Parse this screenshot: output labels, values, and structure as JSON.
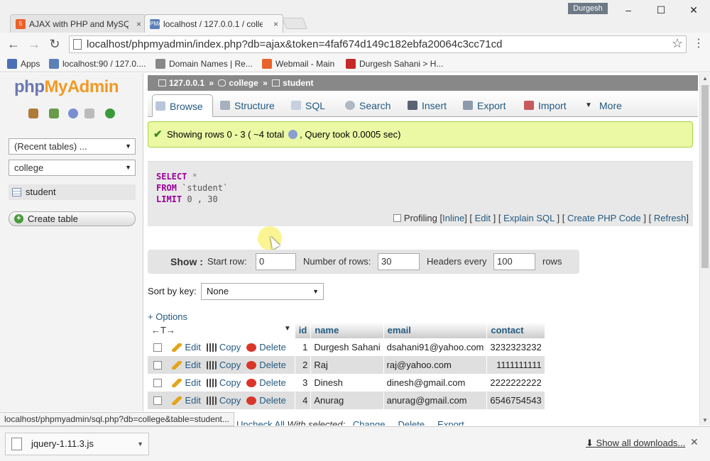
{
  "browser": {
    "tabs": [
      {
        "title": "AJAX with PHP and MySQ",
        "favicon": "html-icon"
      },
      {
        "title": "localhost / 127.0.0.1 / colle",
        "favicon": "pma-icon"
      }
    ],
    "tab_close": "×",
    "profile": "Durgesh",
    "url": "localhost/phpmyadmin/index.php?db=ajax&token=4faf674d149c182ebfa20064c3cc71cd",
    "bookmarks": [
      {
        "label": "Apps",
        "color": "#4a6fb5"
      },
      {
        "label": "localhost:90 / 127.0....",
        "color": "#5b7fb8"
      },
      {
        "label": "Domain Names | Re...",
        "color": "#888888"
      },
      {
        "label": "Webmail - Main",
        "color": "#e8622a"
      },
      {
        "label": "Durgesh Sahani > H...",
        "color": "#c62828"
      }
    ],
    "status_url": "localhost/phpmyadmin/sql.php?db=college&table=student...",
    "download_file": "jquery-1.11.3.js",
    "show_all_downloads": "Show all downloads..."
  },
  "nav": {
    "logo_part1": "php",
    "logo_part2": "MyAdmin",
    "recent_tables": "(Recent tables) ...",
    "database": "college",
    "table": "student",
    "create_table": "Create table"
  },
  "breadcrumb": {
    "server": "127.0.0.1",
    "database": "college",
    "table": "student",
    "separator": "»"
  },
  "tabs": [
    "Browse",
    "Structure",
    "SQL",
    "Search",
    "Insert",
    "Export",
    "Import",
    "More"
  ],
  "message": {
    "text": "Showing rows 0 - 3 ( ~4 total",
    "query_time": ", Query took 0.0005 sec)"
  },
  "sql": {
    "kw_select": "SELECT",
    "star": "*",
    "kw_from": "FROM",
    "table": "`student`",
    "kw_limit": "LIMIT",
    "limit_vals": "0 , 30",
    "profiling": "Profiling",
    "links": [
      "Inline",
      "Edit",
      "Explain SQL",
      "Create PHP Code",
      "Refresh"
    ]
  },
  "show": {
    "label": "Show :",
    "start_row_label": "Start row:",
    "start_row": "0",
    "num_rows_label": "Number of rows:",
    "num_rows": "30",
    "headers_every_label": "Headers every",
    "headers_every": "100",
    "rows_label": "rows"
  },
  "sort": {
    "label": "Sort by key:",
    "value": "None"
  },
  "options_label": "+ Options",
  "table": {
    "column_controls": "←T→",
    "headers": [
      "id",
      "name",
      "email",
      "contact"
    ],
    "actions": [
      "Edit",
      "Copy",
      "Delete"
    ],
    "rows": [
      {
        "id": "1",
        "name": "Durgesh Sahani",
        "email": "dsahani91@yahoo.com",
        "contact": "3232323232"
      },
      {
        "id": "2",
        "name": "Raj",
        "email": "raj@yahoo.com",
        "contact": "1111111111"
      },
      {
        "id": "3",
        "name": "Dinesh",
        "email": "dinesh@gmail.com",
        "contact": "2222222222"
      },
      {
        "id": "4",
        "name": "Anurag",
        "email": "anurag@gmail.com",
        "contact": "6546754543"
      }
    ]
  },
  "bulk": {
    "check_all": "Uncheck All",
    "with_selected": "With selected:",
    "change": "Change",
    "delete": "Delete",
    "export": "Export"
  },
  "colors": {
    "pma_link": "#235a81",
    "success_bg": "#ebf8a4",
    "logo_blue": "#6c78af",
    "logo_orange": "#f29a24"
  }
}
